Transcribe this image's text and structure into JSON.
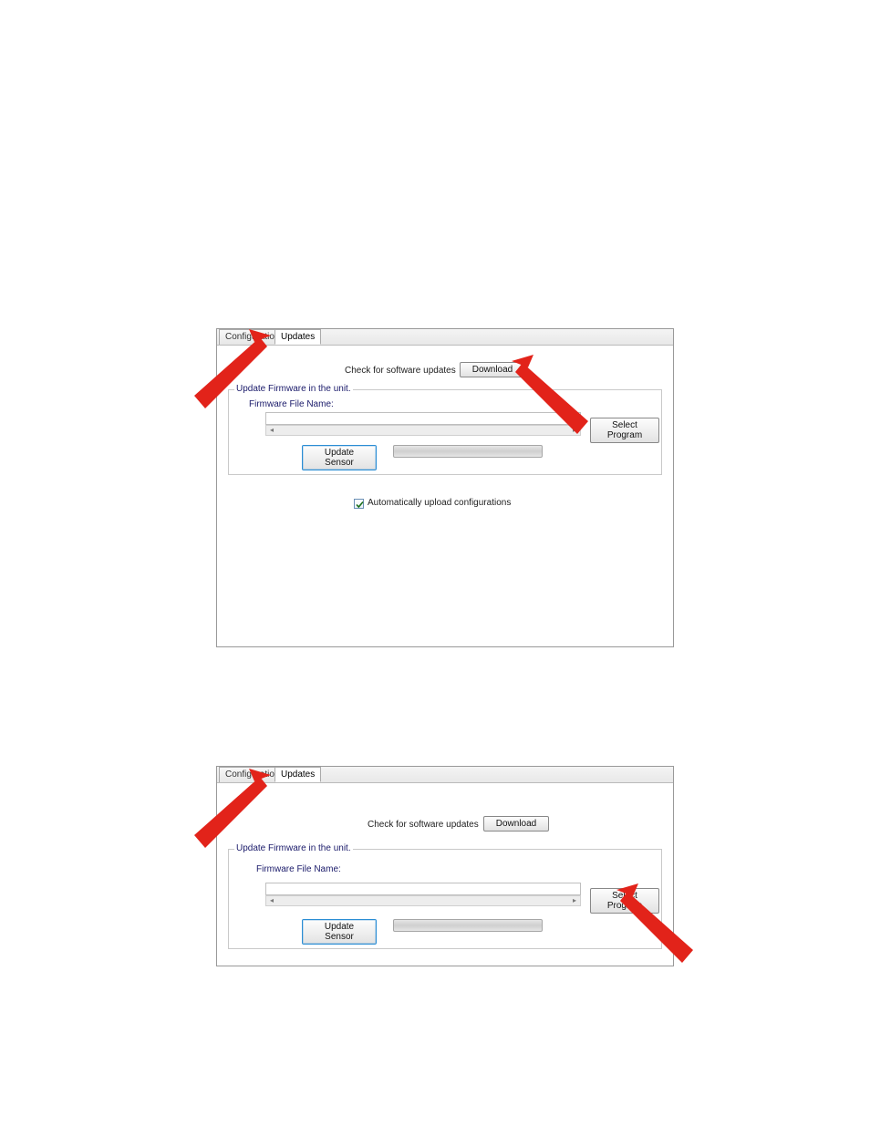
{
  "tabs": {
    "configuration": "Configuration",
    "updates": "Updates"
  },
  "check_updates_label": "Check for software updates",
  "download_btn": "Download",
  "group_legend": "Update Firmware in the unit.",
  "firmware_label": "Firmware File Name:",
  "firmware_value": "",
  "select_program_btn": "Select Program",
  "update_sensor_btn": "Update Sensor",
  "auto_upload_label": "Automatically upload configurations",
  "auto_upload_checked": true,
  "arrow_color": "#e2231a"
}
